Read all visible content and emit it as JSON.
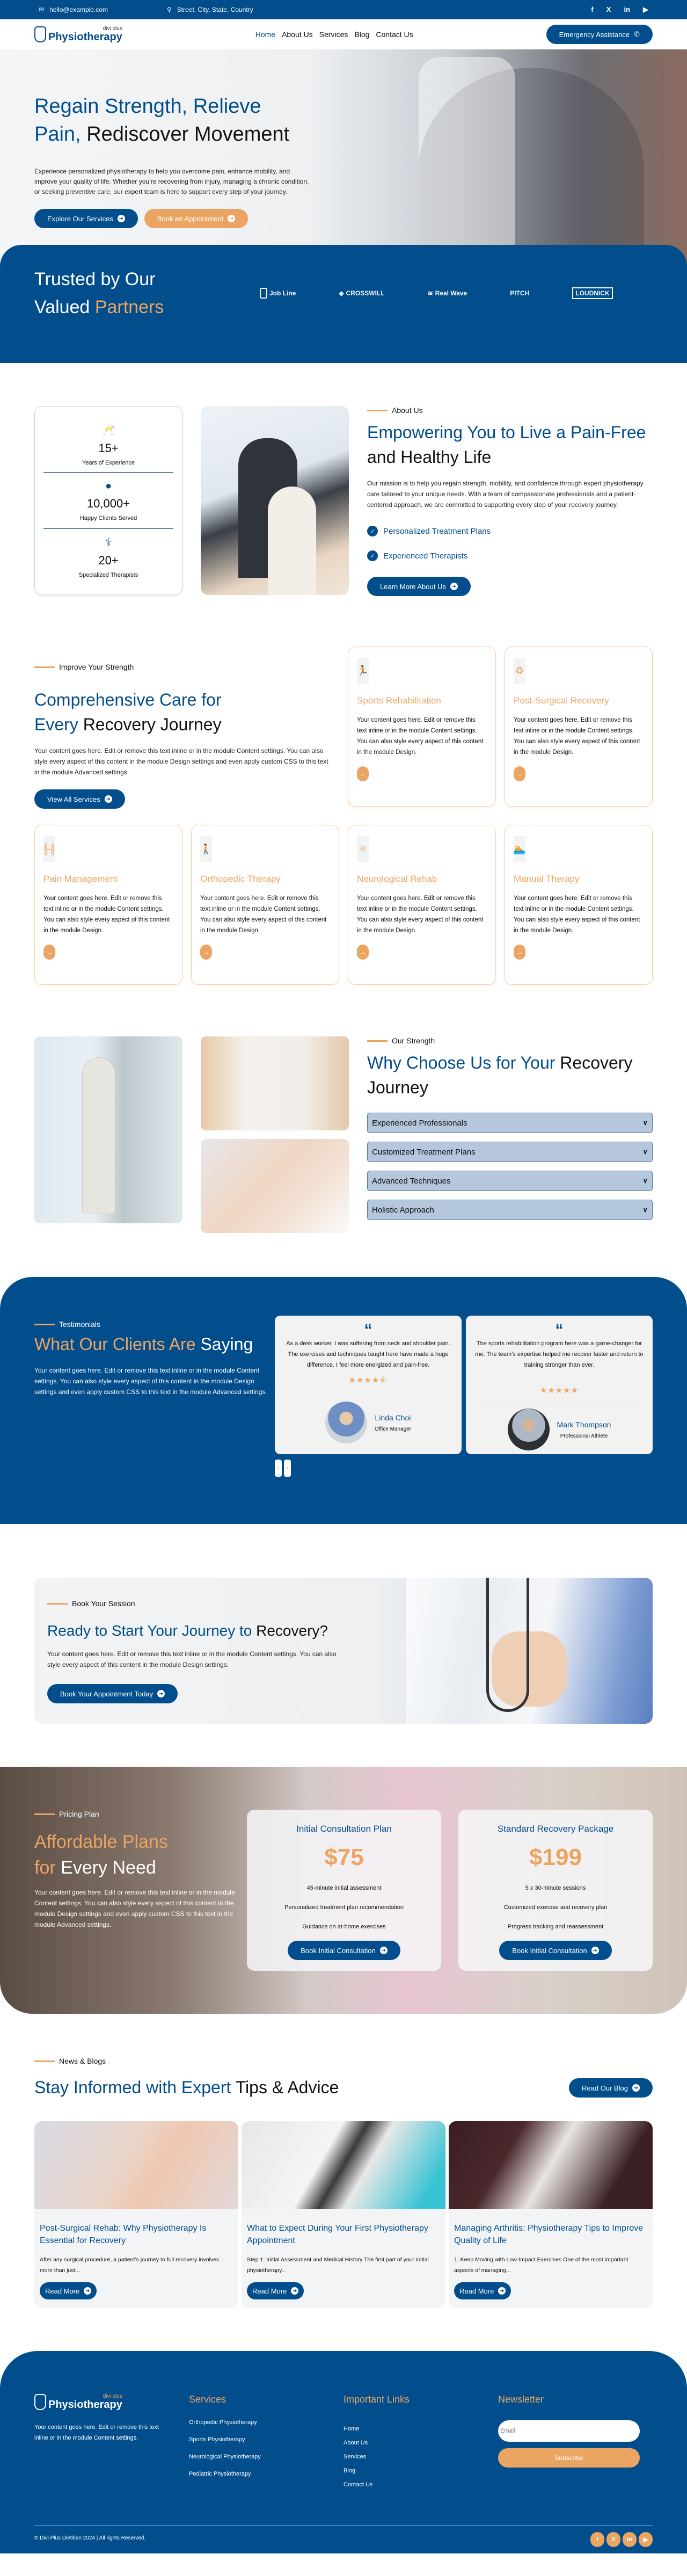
{
  "topbar": {
    "email": "hello@example.com",
    "address": "Street, City, State, Country",
    "social": [
      "f",
      "X",
      "in",
      "▶"
    ]
  },
  "nav": {
    "logo_small": "divi plus",
    "logo_big": "Physiotherapy",
    "menu": [
      "Home",
      "About Us",
      "Services",
      "Blog",
      "Contact Us"
    ],
    "active": "Home",
    "cta": "Emergency Assistance"
  },
  "hero": {
    "title_blue_1": "Regain Strength, Relieve",
    "title_blue_2": "Pain,",
    "title_dark": "Rediscover Movement",
    "text": "Experience personalized physiotherapy to help you overcome pain, enhance mobility, and improve your quality of life. Whether you’re recovering from injury, managing a chronic condition, or seeking preventive care, our expert team is here to support every step of your journey.",
    "btn_primary": "Explore Our Services",
    "btn_secondary": "Book an Appointment"
  },
  "partners": {
    "title_1": "Trusted by Our",
    "title_2": "Valued",
    "title_orange": "Partners",
    "logos": [
      "Job Line",
      "CROSSWILL",
      "Real Wave",
      "PITCH",
      "LOUDNICK"
    ]
  },
  "about": {
    "stats": [
      {
        "icon": "award-icon",
        "value": "15+",
        "label": "Years of Experience"
      },
      {
        "icon": "user-icon",
        "value": "10,000+",
        "label": "Happy Clients Served"
      },
      {
        "icon": "doctor-icon",
        "value": "20+",
        "label": "Specialized Therapists"
      }
    ],
    "eyebrow": "About Us",
    "title_blue": "Empowering You to Live a Pain-Free",
    "title_dark": "and Healthy Life",
    "text": "Our mission is to help you regain strength, mobility, and confidence through expert physiotherapy care tailored to your unique needs. With a team of compassionate professionals and a patient-centered approach, we are committed to supporting every step of your recovery journey.",
    "checks": [
      "Personalized Treatment Plans",
      "Experienced Therapists"
    ],
    "button": "Learn More About Us"
  },
  "services": {
    "eyebrow": "Improve Your Strength",
    "title_blue_1": "Comprehensive Care for",
    "title_blue_2": "Every",
    "title_dark": "Recovery Journey",
    "text": "Your content goes here. Edit or remove this text inline or in the module Content settings. You can also style every aspect of this content in the module Design settings and even apply custom CSS to this text in the module Advanced settings.",
    "button": "View All Services",
    "card_text": "Your content goes here. Edit or remove this text inline or in the module Content settings. You can also style every aspect of this content in the module Design.",
    "cards": [
      {
        "title": "Sports Rehabilitation",
        "icon": "running-icon"
      },
      {
        "title": "Post-Surgical Recovery",
        "icon": "recycle-icon"
      },
      {
        "title": "Pain Management",
        "icon": "dumbbell-icon"
      },
      {
        "title": "Orthopedic Therapy",
        "icon": "walking-icon"
      },
      {
        "title": "Neurological Rehab",
        "icon": "atom-icon"
      },
      {
        "title": "Manual Therapy",
        "icon": "swimmer-icon"
      }
    ]
  },
  "why": {
    "eyebrow": "Our Strength",
    "title_blue": "Why Choose Us for Your",
    "title_dark": "Recovery Journey",
    "accordion": [
      "Experienced Professionals",
      "Customized Treatment Plans",
      "Advanced Techniques",
      "Holistic Approach"
    ]
  },
  "testimonials": {
    "eyebrow": "Testimonials",
    "title_orange": "What Our Clients Are",
    "title_white": "Saying",
    "text": "Your content goes here. Edit or remove this text inline or in the module Content settings. You can also style every aspect of this content in the module Design settings and even apply custom CSS to this text in the module Advanced settings.",
    "items": [
      {
        "quote": "As a desk worker, I was suffering from neck and shoulder pain. The exercises and techniques taught here have made a huge difference. I feel more energized and pain-free.",
        "rating": 4.5,
        "stars": "★★★★⯪",
        "name": "Linda Choi",
        "role": "Office Manager"
      },
      {
        "quote": "The sports rehabilitation program here was a game-changer for me. The team’s expertise helped me recover faster and return to training stronger than ever.",
        "rating": 5,
        "stars": "★★★★★",
        "name": "Mark Thompson",
        "role": "Professional Athlete"
      }
    ],
    "prev": "‹",
    "next": "›"
  },
  "cta": {
    "eyebrow": "Book Your Session",
    "title_blue": "Ready to Start Your Journey to",
    "title_dark": "Recovery?",
    "text": "Your content goes here. Edit or remove this text inline or in the module Content settings. You can also style every aspect of this content in the module Design settings.",
    "button": "Book Your Appointment Today"
  },
  "pricing": {
    "eyebrow": "Pricing Plan",
    "title_orange_1": "Affordable Plans",
    "title_orange_2": "for",
    "title_white": "Every Need",
    "text": "Your content goes here. Edit or remove this text inline or in the module Content settings. You can also style every aspect of this content in the module Design settings and even apply custom CSS to this text in the module Advanced settings.",
    "plans": [
      {
        "name": "Initial Consultation Plan",
        "price": "$75",
        "features": [
          "45-minute initial assessment",
          "Personalized treatment plan recommendation",
          "Guidance on at-home exercises"
        ],
        "button": "Book Initial Consultation"
      },
      {
        "name": "Standard Recovery Package",
        "price": "$199",
        "features": [
          "5 x 30-minute sessions",
          "Customized exercise and recovery plan",
          "Progress tracking and reassessment"
        ],
        "button": "Book Initial Consultation"
      }
    ]
  },
  "blog": {
    "eyebrow": "News & Blogs",
    "title_blue": "Stay Informed with Expert",
    "title_dark": "Tips & Advice",
    "button": "Read Our Blog",
    "posts": [
      {
        "title": "Post-Surgical Rehab: Why Physiotherapy Is Essential for Recovery",
        "excerpt": "After any surgical procedure, a patient’s journey to full recovery involves more than just...",
        "button": "Read More"
      },
      {
        "title": "What to Expect During Your First Physiotherapy Appointment",
        "excerpt": "Step 1: Initial Assessment and Medical History The first part of your initial physiotherapy...",
        "button": "Read More"
      },
      {
        "title": "Managing Arthritis: Physiotherapy Tips to Improve Quality of Life",
        "excerpt": "1. Keep Moving with Low-Impact Exercises One of the most important aspects of managing...",
        "button": "Read More"
      }
    ]
  },
  "footer": {
    "logo_small": "divi plus",
    "logo_big": "Physiotherapy",
    "text": "Your content goes here. Edit or remove this text inline or in the module Content settings.",
    "services_title": "Services",
    "services": [
      "Orthopedic Physiotherapy",
      "Sports Physiotherapy",
      "Neurological Physiotherapy",
      "Pediatric Physiotherapy"
    ],
    "links_title": "Important Links",
    "links": [
      "Home",
      "About Us",
      "Services",
      "Blog",
      "Contact Us"
    ],
    "newsletter_title": "Newsletter",
    "email_placeholder": "Email",
    "subscribe": "Subscribe",
    "copyright": "© Divi Plus Dietitian 2024 | All rights Reserved.",
    "social": [
      "f",
      "X",
      "in",
      "▶"
    ]
  },
  "colors": {
    "primary": "#024d8c",
    "accent": "#eba563"
  }
}
